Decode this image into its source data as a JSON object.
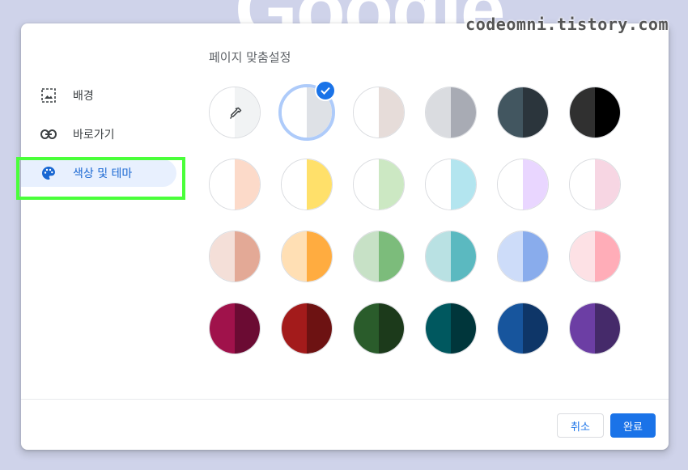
{
  "background": {
    "logo_text": "Google"
  },
  "watermark": "codeomni.tistory.com",
  "dialog": {
    "title": "페이지 맞춤설정",
    "nav": [
      {
        "label": "배경",
        "icon": "image-icon",
        "active": false
      },
      {
        "label": "바로가기",
        "icon": "link-icon",
        "active": false
      },
      {
        "label": "색상 및 테마",
        "icon": "palette-icon",
        "active": true
      }
    ],
    "swatches": [
      [
        {
          "left": "#ffffff",
          "right": "#f1f3f4",
          "custom": true
        },
        {
          "left": "#ffffff",
          "right": "#dee1e6",
          "selected": true
        },
        {
          "left": "#ffffff",
          "right": "#e6dcd9"
        },
        {
          "left": "#dadce0",
          "right": "#a8abb4"
        },
        {
          "left": "#425660",
          "right": "#2b353c"
        },
        {
          "left": "#303030",
          "right": "#000000"
        }
      ],
      [
        {
          "left": "#ffffff",
          "right": "#fcdac9"
        },
        {
          "left": "#ffffff",
          "right": "#ffe06a"
        },
        {
          "left": "#ffffff",
          "right": "#cce8c3"
        },
        {
          "left": "#ffffff",
          "right": "#b3e5ef"
        },
        {
          "left": "#ffffff",
          "right": "#e9d6ff"
        },
        {
          "left": "#ffffff",
          "right": "#f7d6e3"
        }
      ],
      [
        {
          "left": "#f4dfd8",
          "right": "#e3a996"
        },
        {
          "left": "#ffdfb4",
          "right": "#ffac40"
        },
        {
          "left": "#c7e1c6",
          "right": "#7cbc7b"
        },
        {
          "left": "#b9e1e3",
          "right": "#5bb9c0"
        },
        {
          "left": "#cddcf9",
          "right": "#89acec"
        },
        {
          "left": "#fde1e5",
          "right": "#ffadb8"
        }
      ],
      [
        {
          "left": "#a0124b",
          "right": "#6b0b33"
        },
        {
          "left": "#a31b1b",
          "right": "#6d1212"
        },
        {
          "left": "#2a5c2b",
          "right": "#1c3a1b"
        },
        {
          "left": "#00585f",
          "right": "#00363b"
        },
        {
          "left": "#17559d",
          "right": "#0e3668"
        },
        {
          "left": "#6c3ea4",
          "right": "#452a6a"
        }
      ]
    ],
    "buttons": {
      "cancel": "취소",
      "done": "완료"
    }
  },
  "colors": {
    "accent": "#1a73e8",
    "highlight_box": "#4aff3a",
    "nav_active_bg": "#e8f0fe"
  }
}
